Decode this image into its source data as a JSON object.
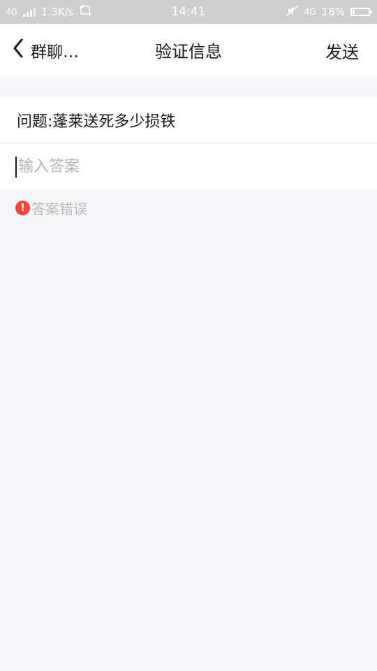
{
  "status_bar": {
    "network_left": "4G",
    "speed": "1.3K/s",
    "time": "14:41",
    "network_right": "4G",
    "battery": "18%"
  },
  "nav": {
    "back_label": "群聊…",
    "title": "验证信息",
    "send_label": "发送"
  },
  "form": {
    "question": "问题:蓬莱送死多少损铁",
    "answer_value": "",
    "answer_placeholder": "输入答案",
    "error_text": "答案错误"
  },
  "colors": {
    "error_icon": "#f0453a",
    "background": "#f7f7f9"
  }
}
